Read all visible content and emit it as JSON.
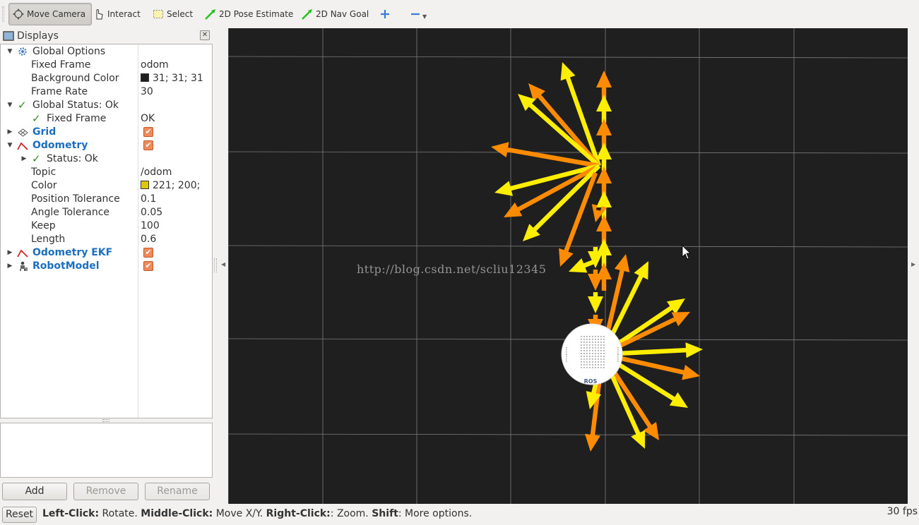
{
  "toolbar": {
    "tools": [
      {
        "label": "Move Camera",
        "icon": "move-camera-icon",
        "active": true
      },
      {
        "label": "Interact",
        "icon": "hand-pointer-icon"
      },
      {
        "label": "Select",
        "icon": "select-box-icon"
      },
      {
        "label": "2D Pose Estimate",
        "icon": "green-arrow-icon"
      },
      {
        "label": "2D Nav Goal",
        "icon": "green-arrow-icon"
      }
    ],
    "add_icon": "plus-icon",
    "remove_icon": "minus-icon",
    "menu_icon": "dropdown-triangle-icon"
  },
  "displays": {
    "title": "Displays",
    "rows": [
      {
        "label": "Global Options",
        "value": ""
      },
      {
        "label": "Fixed Frame",
        "value": "odom"
      },
      {
        "label": "Background Color",
        "value": "31; 31; 31",
        "swatch": "#1f1f1f"
      },
      {
        "label": "Frame Rate",
        "value": "30"
      },
      {
        "label": "Global Status: Ok",
        "value": ""
      },
      {
        "label": "Fixed Frame",
        "value": "OK"
      },
      {
        "label": "Grid",
        "value": "",
        "checked": true
      },
      {
        "label": "Odometry",
        "value": "",
        "checked": true
      },
      {
        "label": "Status: Ok",
        "value": ""
      },
      {
        "label": "Topic",
        "value": "/odom"
      },
      {
        "label": "Color",
        "value": "221; 200;",
        "swatch": "#ddc800"
      },
      {
        "label": "Position Tolerance",
        "value": "0.1"
      },
      {
        "label": "Angle Tolerance",
        "value": "0.05"
      },
      {
        "label": "Keep",
        "value": "100"
      },
      {
        "label": "Length",
        "value": "0.6"
      },
      {
        "label": "Odometry EKF",
        "value": "",
        "checked": true
      },
      {
        "label": "RobotModel",
        "value": "",
        "checked": true
      }
    ]
  },
  "buttons": {
    "add": "Add",
    "remove": "Remove",
    "rename": "Rename"
  },
  "view": {
    "background": "#1f1f1f",
    "watermark": "http://blog.csdn.net/scliu12345",
    "robot_label": "ROS",
    "arrow_colors": {
      "orange": "#ff8c00",
      "yellow": "#ffee00"
    }
  },
  "statusbar": {
    "reset": "Reset",
    "help": [
      {
        "key": "Left-Click:",
        "text": " Rotate. "
      },
      {
        "key": "Middle-Click:",
        "text": " Move X/Y. "
      },
      {
        "key": "Right-Click:",
        "text": ": Zoom. "
      },
      {
        "key": "Shift",
        "text": ": More options."
      }
    ],
    "fps": "30 fps"
  }
}
